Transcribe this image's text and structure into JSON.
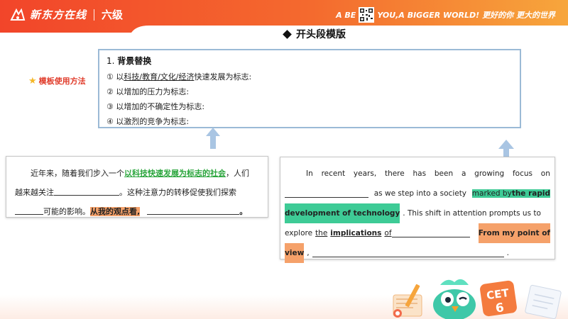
{
  "header": {
    "brand_name": "新东方在线",
    "level": "六级",
    "slogan_start": "A BE",
    "slogan_end": "YOU,A BIGGER WORLD!",
    "slogan_cn": "更好的你 更大的世界"
  },
  "section": {
    "title": "开头段模版"
  },
  "method_label": "模板使用方法",
  "replacement": {
    "heading_num": "1. ",
    "heading": "背景替换",
    "items": [
      {
        "num": "① 以",
        "underlined": "科技/教育/文化/经济",
        "rest": "快速发展为标志:"
      },
      {
        "num": "② 以增加的压力为标志:",
        "underlined": "",
        "rest": ""
      },
      {
        "num": "③ 以增加的不确定性为标志:",
        "underlined": "",
        "rest": ""
      },
      {
        "num": "④ 以激烈的竞争为标志:",
        "underlined": "",
        "rest": ""
      }
    ]
  },
  "cn_text": {
    "p1": "近年来，随着我们步入一个",
    "green": "以科技快速发展为标志的社会",
    "p2": "，人们",
    "p3": "越来越关注",
    "p4": "。这种注意力的转移促使我们探索",
    "p5": "可能的影响。",
    "orange": "从我的观点看,",
    "p6": "。"
  },
  "en_text": {
    "line1": [
      "In",
      "recent",
      "years,",
      "there",
      "has",
      "been",
      "a",
      "growing",
      "focus",
      "on"
    ],
    "line2_mid": "as we step into a society",
    "line2_green": "marked by",
    "line2_green_bold": "the rapid",
    "line3_green": "development of technology",
    "line3_rest": ". This shift in attention prompts us to",
    "line4_a": "explore",
    "line4_u1": "the",
    "line4_u2": "implications",
    "line4_u3": "of",
    "line4_orange": "From my point of",
    "line5_orange": "view",
    "line5_end": "."
  },
  "footer": {
    "badge": "CET",
    "badge_num": "6"
  }
}
